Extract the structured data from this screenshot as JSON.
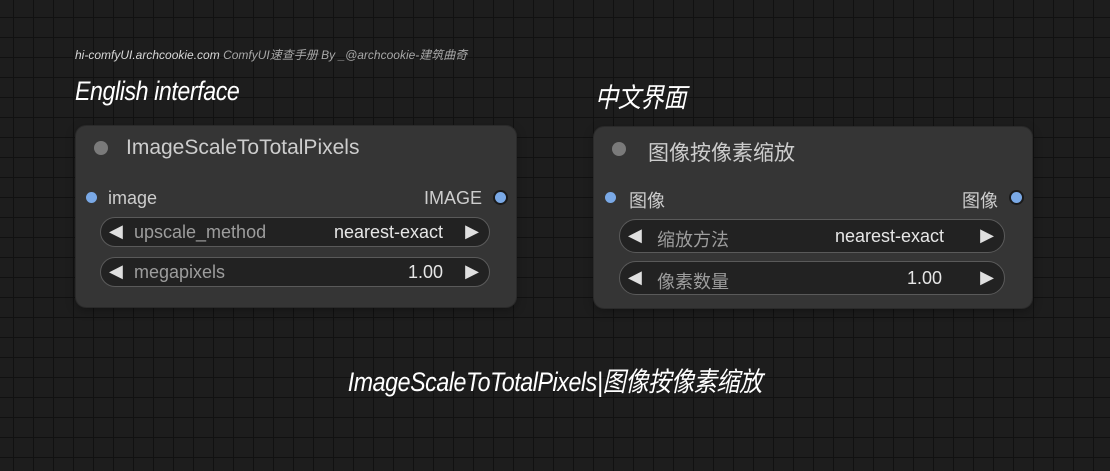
{
  "credit": {
    "site": "hi-comfyUI.archcookie.com",
    "text": "ComfyUI速查手册 By _@archcookie-建筑曲奇"
  },
  "labels": {
    "english": "English interface",
    "chinese": "中文界面"
  },
  "caption": "ImageScaleToTotalPixels|图像按像素缩放",
  "nodes": {
    "en": {
      "title": "ImageScaleToTotalPixels",
      "input": "image",
      "output": "IMAGE",
      "widgets": [
        {
          "name": "upscale_method",
          "value": "nearest-exact"
        },
        {
          "name": "megapixels",
          "value": "1.00"
        }
      ]
    },
    "zh": {
      "title": "图像按像素缩放",
      "input": "图像",
      "output": "图像",
      "widgets": [
        {
          "name": "缩放方法",
          "value": "nearest-exact"
        },
        {
          "name": "像素数量",
          "value": "1.00"
        }
      ]
    }
  },
  "colors": {
    "canvas": "#1d1d1d",
    "grid": "#111111",
    "node": "#353535",
    "slot": "#7aa9e6"
  },
  "icons": {
    "decrement": "◀",
    "increment": "▶"
  }
}
